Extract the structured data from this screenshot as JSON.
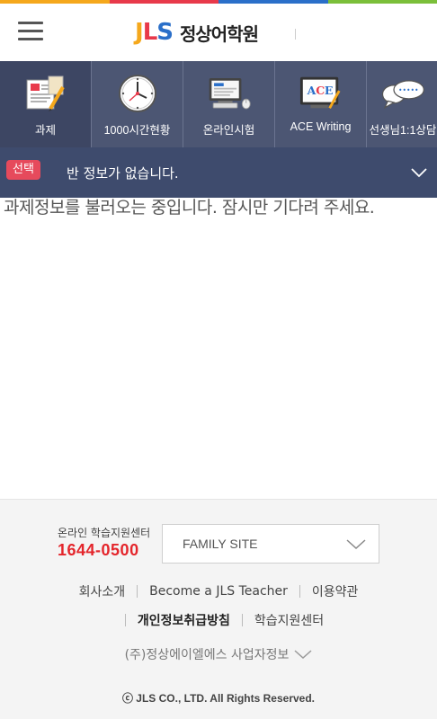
{
  "colors": {
    "stripe": [
      "#f5a81c",
      "#e8394a",
      "#2a6fc9",
      "#7bbf3a"
    ],
    "menu_bg": "#4c5673",
    "class_bar_bg": "#3e4b6d",
    "badge_bg": "#e64a5c",
    "phone": "#e4252b"
  },
  "header": {
    "logo_mark": [
      "J",
      "L",
      "S"
    ],
    "logo_text": "정상어학원"
  },
  "menu": {
    "items": [
      {
        "label": "과제",
        "icon": "homework-icon"
      },
      {
        "label": "1000시간현황",
        "icon": "clock-icon"
      },
      {
        "label": "온라인시험",
        "icon": "computer-icon"
      },
      {
        "label": "ACE Writing",
        "icon": "ace-writing-icon"
      },
      {
        "label": "선생님1:1상담",
        "icon": "chat-bubble-icon"
      }
    ]
  },
  "class_bar": {
    "badge": "선택",
    "text": "반 정보가 없습니다."
  },
  "main": {
    "loading": "과제정보를 불러오는 중입니다. 잠시만 기다려 주세요."
  },
  "footer": {
    "support_label": "온라인 학습지원센터",
    "support_phone": "1644-0500",
    "family_site": "FAMILY SITE",
    "links_row1": [
      "회사소개",
      "Become a JLS Teacher",
      "이용약관"
    ],
    "links_row2": [
      "개인정보취급방침",
      "학습지원센터"
    ],
    "biz_info": "(주)정상에이엘에스 사업자정보",
    "copyright": "ⓒ JLS CO., LTD. All Rights Reserved."
  }
}
